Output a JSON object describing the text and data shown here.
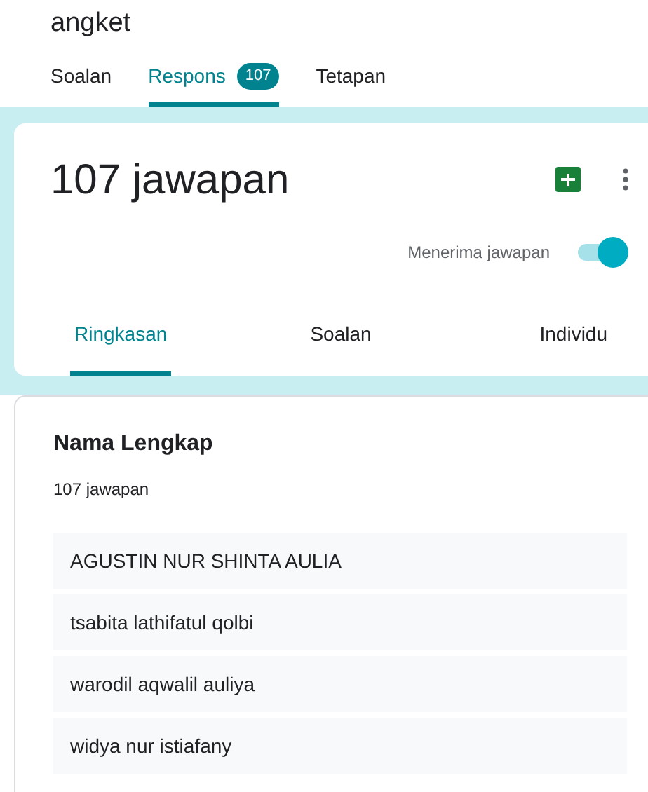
{
  "form_title": "angket",
  "tabs": [
    {
      "label": "Soalan",
      "selected": false
    },
    {
      "label": "Respons",
      "badge": "107",
      "selected": true
    },
    {
      "label": "Tetapan",
      "selected": false
    }
  ],
  "summary": {
    "title": "107 jawapan",
    "accepting": {
      "label": "Menerima jawapan",
      "on": true
    }
  },
  "view_tabs": [
    {
      "label": "Ringkasan",
      "selected": true
    },
    {
      "label": "Soalan",
      "selected": false
    },
    {
      "label": "Individu",
      "selected": false
    }
  ],
  "question": {
    "title": "Nama Lengkap",
    "count": "107 jawapan",
    "answers": [
      "AGUSTIN NUR SHINTA AULIA",
      "tsabita lathifatul qolbi",
      "warodil aqwalil auliya",
      "widya nur istiafany"
    ]
  }
}
